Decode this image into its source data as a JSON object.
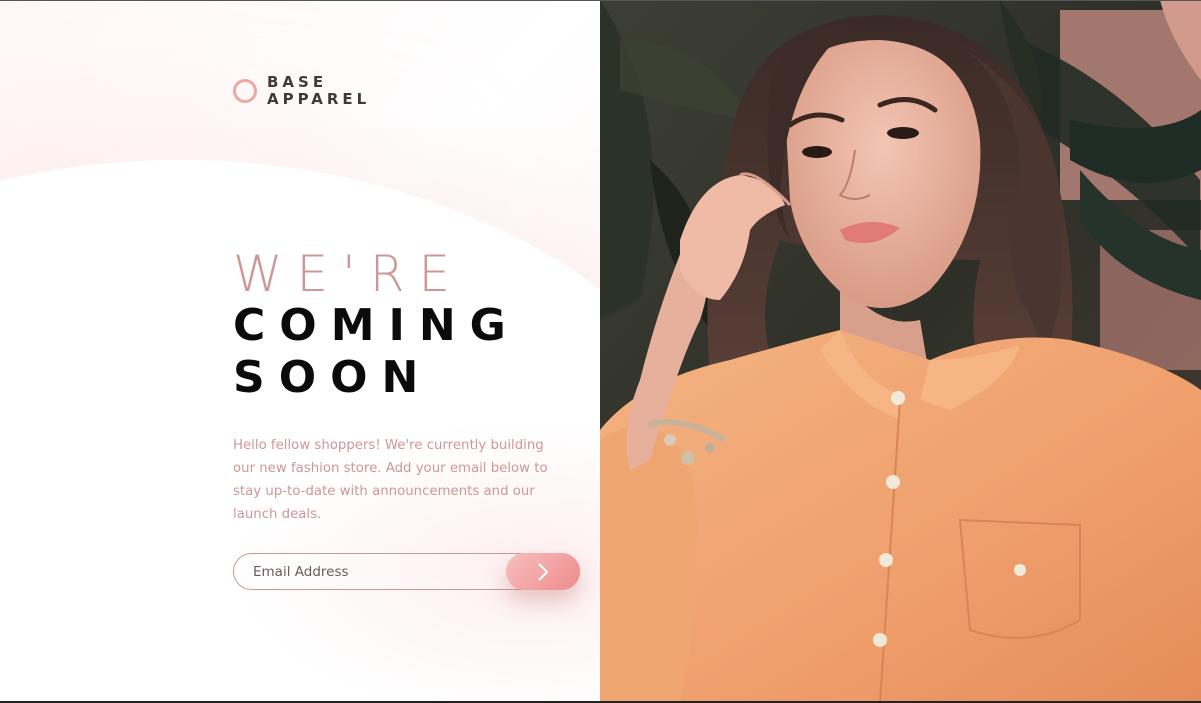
{
  "brand": {
    "line1": "BASE",
    "line2": "APPAREL",
    "accent_color": "#eea6a6"
  },
  "headline": {
    "line1": "WE'RE",
    "line2": "COMING",
    "line3": "SOON"
  },
  "intro": "Hello fellow shoppers! We're currently building our new fashion store. Add your email below to stay up-to-date with announcements and our launch deals.",
  "form": {
    "email_placeholder": "Email Address",
    "submit_icon": "chevron-right-icon"
  },
  "hero": {
    "image": "woman in orange shirt with bracelet, plants background"
  },
  "colors": {
    "text_pink": "#ce9797",
    "text_dark": "#423a3a",
    "button_gradient_start": "#f8bfbf",
    "button_gradient_end": "#ee8c8c",
    "shirt": "#f0a672"
  }
}
